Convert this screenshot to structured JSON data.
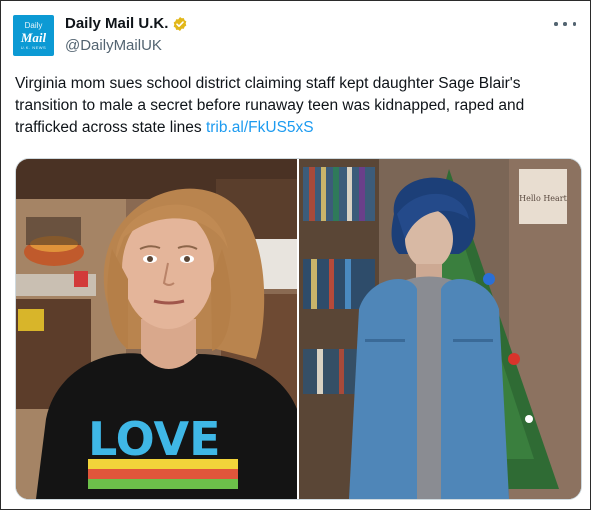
{
  "tweet": {
    "author": {
      "avatar_line1": "Daily",
      "avatar_line2": "Mail",
      "avatar_line3": "U.K. NEWS",
      "display_name": "Daily Mail U.K.",
      "handle": "@DailyMailUK"
    },
    "text": "Virginia mom sues school district claiming staff kept daughter Sage Blair's transition to male a secret before runaway teen was kidnapped, raped and trafficked across state lines ",
    "link": "trib.al/FkUS5xS",
    "media": {
      "left_photo_shirt_text": "LOVE",
      "right_photo_sign_text": "Hello Heart"
    }
  },
  "icons": {
    "verified": "verified-badge-icon",
    "more": "more-options-icon"
  },
  "colors": {
    "link": "#1d9bf0",
    "verified_gold": "#e2b719",
    "avatar_bg": "#0c9ad4",
    "secondary_text": "#536471"
  }
}
